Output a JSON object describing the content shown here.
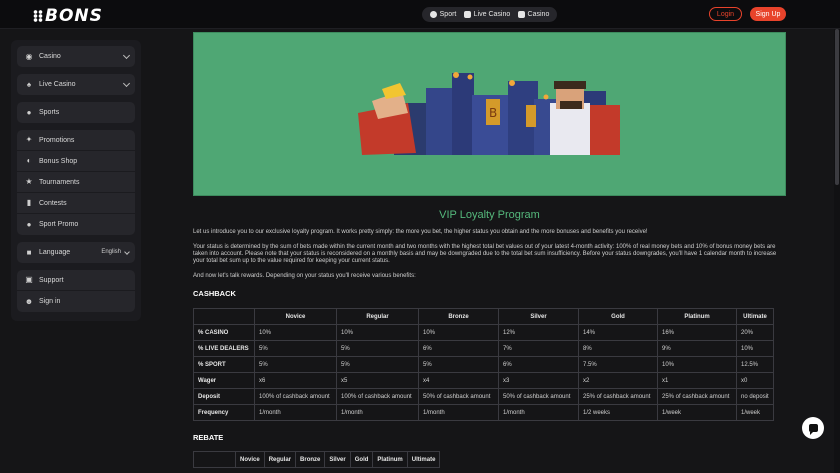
{
  "header": {
    "logo": "BONS",
    "tabs": [
      {
        "label": "Sport",
        "icon": "soccer-ball-icon"
      },
      {
        "label": "Live Casino",
        "icon": "card-club-icon"
      },
      {
        "label": "Casino",
        "icon": "dice-icon"
      }
    ],
    "login_label": "Login",
    "signup_label": "Sign Up",
    "accent_color": "#e8432b"
  },
  "sidebar": {
    "top_items": [
      {
        "label": "Casino",
        "icon": "casino-icon",
        "expandable": true
      },
      {
        "label": "Live Casino",
        "icon": "live-casino-icon",
        "expandable": true
      },
      {
        "label": "Sports",
        "icon": "soccer-ball-icon",
        "expandable": false
      }
    ],
    "promo_items": [
      {
        "label": "Promotions",
        "icon": "megaphone-icon"
      },
      {
        "label": "Bonus Shop",
        "icon": "shop-icon"
      },
      {
        "label": "Tournaments",
        "icon": "trophy-icon"
      },
      {
        "label": "Contests",
        "icon": "bar-chart-icon"
      },
      {
        "label": "Sport Promo",
        "icon": "soccer-ball-icon"
      }
    ],
    "language": {
      "label": "Language",
      "value": "English"
    },
    "support_items": [
      {
        "label": "Support",
        "icon": "chat-icon"
      },
      {
        "label": "Sign in",
        "icon": "user-icon"
      }
    ]
  },
  "main": {
    "title": "VIP Loyalty Program",
    "title_color": "#55b87c",
    "intro": "Let us introduce you to our exclusive loyalty program. It works pretty simply: the more you bet, the higher status you obtain and the more bonuses and benefits you receive!",
    "status_text": "Your status is determined by the sum of bets made within the current month and two months with the highest total bet values out of your latest 4-month activity: 100% of real money bets and 10% of bonus money bets are taken into account. Please note that your status is reconsidered on a monthly basis and may be downgraded due to the total bet sum insufficiency. Before your status downgrades, you'll have 1 calendar month to increase your total bet sum up to the value required for keeping your current status.",
    "rewards_text": "And now let's talk rewards. Depending on your status you'll receive various benefits:",
    "cashback": {
      "title": "CASHBACK",
      "headers": [
        "",
        "Novice",
        "Regular",
        "Bronze",
        "Silver",
        "Gold",
        "Platinum",
        "Ultimate"
      ],
      "rows": [
        [
          "% CASINO",
          "10%",
          "10%",
          "10%",
          "12%",
          "14%",
          "16%",
          "20%"
        ],
        [
          "% LIVE DEALERS",
          "5%",
          "5%",
          "6%",
          "7%",
          "8%",
          "9%",
          "10%"
        ],
        [
          "% SPORT",
          "5%",
          "5%",
          "5%",
          "6%",
          "7.5%",
          "10%",
          "12.5%"
        ],
        [
          "Wager",
          "x6",
          "x5",
          "x4",
          "x3",
          "x2",
          "x1",
          "x0"
        ],
        [
          "Deposit",
          "100% of cashback amount",
          "100% of cashback amount",
          "50% of cashback amount",
          "50% of cashback amount",
          "25% of cashback amount",
          "25% of cashback amount",
          "no deposit"
        ],
        [
          "Frequency",
          "1/month",
          "1/month",
          "1/month",
          "1/month",
          "1/2 weeks",
          "1/week",
          "1/week"
        ]
      ]
    },
    "rebate": {
      "title": "REBATE",
      "headers": [
        "",
        "Novice",
        "Regular",
        "Bronze",
        "Silver",
        "Gold",
        "Platinum",
        "Ultimate"
      ]
    }
  }
}
